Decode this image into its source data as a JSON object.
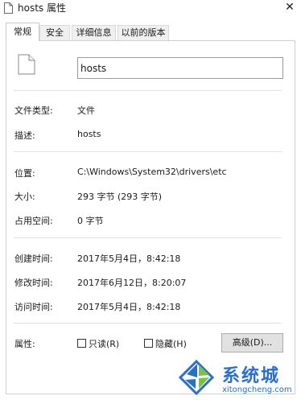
{
  "window": {
    "title": "hosts 属性",
    "close_glyph": "✕"
  },
  "tabs": [
    {
      "label": "常规",
      "active": true
    },
    {
      "label": "安全",
      "active": false
    },
    {
      "label": "详细信息",
      "active": false
    },
    {
      "label": "以前的版本",
      "active": false
    }
  ],
  "general": {
    "file_name": "hosts",
    "rows": {
      "type": {
        "label": "文件类型:",
        "value": "文件"
      },
      "description": {
        "label": "描述:",
        "value": "hosts"
      },
      "location": {
        "label": "位置:",
        "value": "C:\\Windows\\System32\\drivers\\etc"
      },
      "size": {
        "label": "大小:",
        "value": "293 字节 (293 字节)"
      },
      "size_on_disk": {
        "label": "占用空间:",
        "value": "0 字节"
      },
      "created": {
        "label": "创建时间:",
        "value": "2017年5月4日，8:42:18"
      },
      "modified": {
        "label": "修改时间:",
        "value": "2017年6月12日，8:20:07"
      },
      "accessed": {
        "label": "访问时间:",
        "value": "2017年5月4日，8:42:18"
      }
    },
    "attributes": {
      "label": "属性:",
      "readonly_label": "只读(R)",
      "readonly_checked": false,
      "hidden_label": "隐藏(H)",
      "hidden_checked": false,
      "advanced_button": "高级(D)..."
    }
  },
  "watermark": {
    "brand": "系统城",
    "url": "xitongcheng.com"
  },
  "colors": {
    "watermark_blue": "#2a6fc9",
    "watermark_green": "#7cc242"
  }
}
